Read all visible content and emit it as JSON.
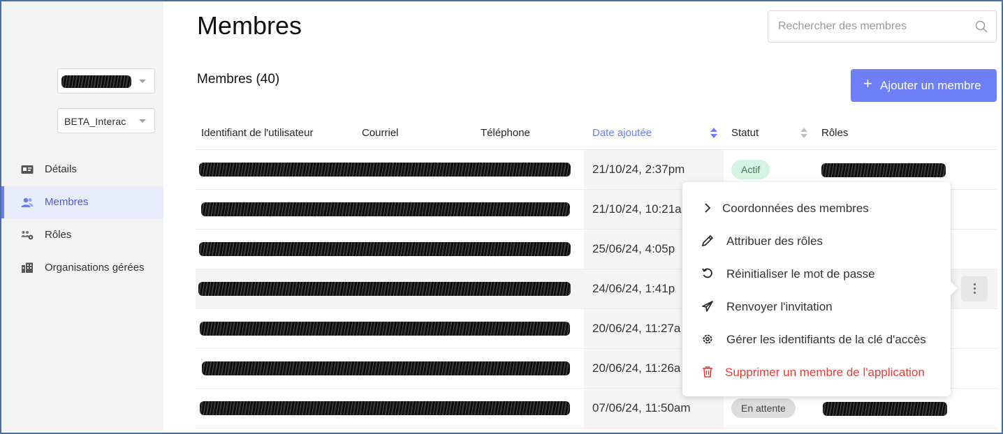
{
  "sidebar": {
    "org_select_value": "",
    "app_select_value": "BETA_Interac",
    "items": [
      {
        "label": "Détails",
        "icon": "id-card-icon"
      },
      {
        "label": "Membres",
        "icon": "users-icon",
        "active": true
      },
      {
        "label": "Rôles",
        "icon": "roles-icon"
      },
      {
        "label": "Organisations gérées",
        "icon": "building-icon"
      }
    ]
  },
  "header": {
    "title": "Membres",
    "search_placeholder": "Rechercher des membres"
  },
  "members": {
    "count_label": "Membres (40)",
    "add_button": "Ajouter un membre"
  },
  "table": {
    "columns": [
      "Identifiant de l'utilisateur",
      "Courriel",
      "Téléphone",
      "Date ajoutée",
      "Statut",
      "Rôles"
    ],
    "rows": [
      {
        "date": "21/10/24, 2:37pm",
        "status": "Actif"
      },
      {
        "date": "21/10/24, 10:21a",
        "status": ""
      },
      {
        "date": "25/06/24, 4:05p",
        "status": ""
      },
      {
        "date": "24/06/24, 1:41p",
        "status": ""
      },
      {
        "date": "20/06/24, 11:27a",
        "status": ""
      },
      {
        "date": "20/06/24, 11:26a",
        "status": ""
      },
      {
        "date": "07/06/24, 11:50am",
        "status": "En attente"
      }
    ]
  },
  "context_menu": {
    "items": [
      {
        "label": "Coordonnées des membres",
        "icon": "chevron-right-icon"
      },
      {
        "label": "Attribuer des rôles",
        "icon": "pencil-icon"
      },
      {
        "label": "Réinitialiser le mot de passe",
        "icon": "reset-icon"
      },
      {
        "label": "Renvoyer l'invitation",
        "icon": "send-icon"
      },
      {
        "label": "Gérer les identifiants de la clé d'accès",
        "icon": "gear-icon"
      },
      {
        "label": "Supprimer un membre de l'application",
        "icon": "trash-icon"
      }
    ]
  },
  "colors": {
    "accent": "#6e7ff6",
    "active_badge_bg": "#d4f3e3",
    "pending_badge_bg": "#dcdcdc",
    "danger": "#e0403a"
  }
}
